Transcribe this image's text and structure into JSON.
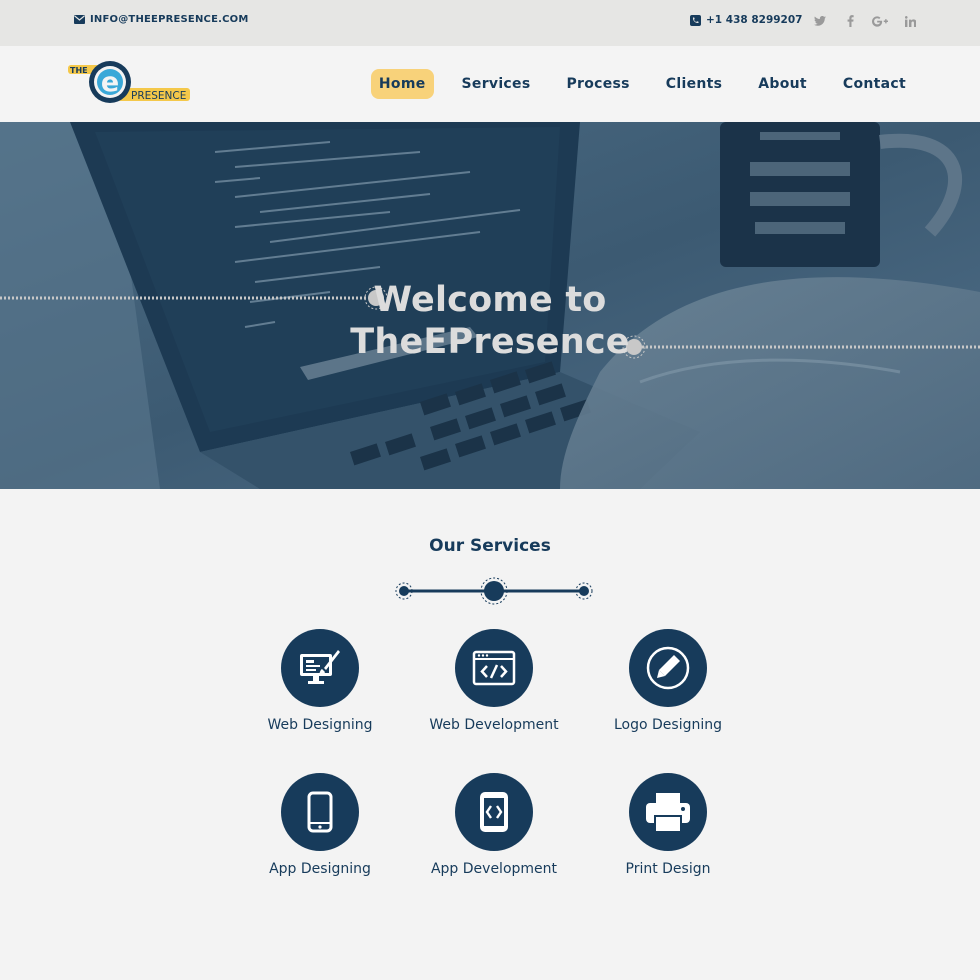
{
  "topbar": {
    "email": "INFO@THEEPRESENCE.COM",
    "phone": "+1 438 8299207",
    "social_icons": [
      "twitter-icon",
      "facebook-icon",
      "google-plus-icon",
      "linkedin-icon"
    ]
  },
  "logo": {
    "the": "THE",
    "e": "e",
    "presence": "PRESENCE"
  },
  "nav": {
    "items": [
      {
        "label": "Home",
        "active": true
      },
      {
        "label": "Services",
        "active": false
      },
      {
        "label": "Process",
        "active": false
      },
      {
        "label": "Clients",
        "active": false
      },
      {
        "label": "About",
        "active": false
      },
      {
        "label": "Contact",
        "active": false
      }
    ]
  },
  "hero": {
    "line1": "Welcome to",
    "line2": "TheEPresence"
  },
  "services": {
    "title": "Our Services",
    "items": [
      {
        "label": "Web Designing",
        "icon": "monitor-brush-icon"
      },
      {
        "label": "Web Development",
        "icon": "code-window-icon"
      },
      {
        "label": "Logo Designing",
        "icon": "pencil-circle-icon"
      },
      {
        "label": "App Designing",
        "icon": "smartphone-icon"
      },
      {
        "label": "App Development",
        "icon": "mobile-code-icon"
      },
      {
        "label": "Print Design",
        "icon": "printer-icon"
      }
    ]
  },
  "colors": {
    "primary": "#173b5b",
    "accent": "#f8d27a",
    "logo_blue": "#3aa8d8",
    "hero_overlay": "#3f5f78"
  }
}
